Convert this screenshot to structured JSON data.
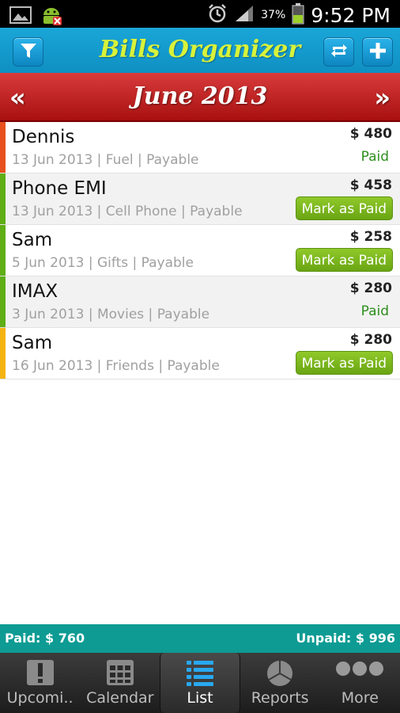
{
  "status": {
    "battery_pct": "37%",
    "time": "9:52 PM"
  },
  "header": {
    "title": "Bills Organizer"
  },
  "month": {
    "title": "June 2013",
    "prev": "«",
    "next": "»"
  },
  "bills": [
    {
      "name": "Dennis",
      "details": "13 Jun 2013 | Fuel | Payable",
      "amount": "$ 480",
      "status": "Paid",
      "color": "#e8501e"
    },
    {
      "name": "Phone EMI",
      "details": "13 Jun 2013 | Cell Phone | Payable",
      "amount": "$ 458",
      "status": "Mark as Paid",
      "color": "#5fae16"
    },
    {
      "name": "Sam",
      "details": "5 Jun 2013 | Gifts | Payable",
      "amount": "$ 258",
      "status": "Mark as Paid",
      "color": "#5fae16"
    },
    {
      "name": "IMAX",
      "details": "3 Jun 2013 | Movies | Payable",
      "amount": "$ 280",
      "status": "Paid",
      "color": "#5fae16"
    },
    {
      "name": "Sam",
      "details": "16 Jun 2013 | Friends | Payable",
      "amount": "$ 280",
      "status": "Mark as Paid",
      "color": "#f5b312"
    }
  ],
  "totals": {
    "paid": "Paid: $ 760",
    "unpaid": "Unpaid: $ 996"
  },
  "tabs": [
    {
      "label": "Upcomi..",
      "icon": "exclamation-icon"
    },
    {
      "label": "Calendar",
      "icon": "calendar-grid-icon"
    },
    {
      "label": "List",
      "icon": "list-icon"
    },
    {
      "label": "Reports",
      "icon": "pie-chart-icon"
    },
    {
      "label": "More",
      "icon": "more-dots-icon"
    }
  ],
  "active_tab": "List"
}
